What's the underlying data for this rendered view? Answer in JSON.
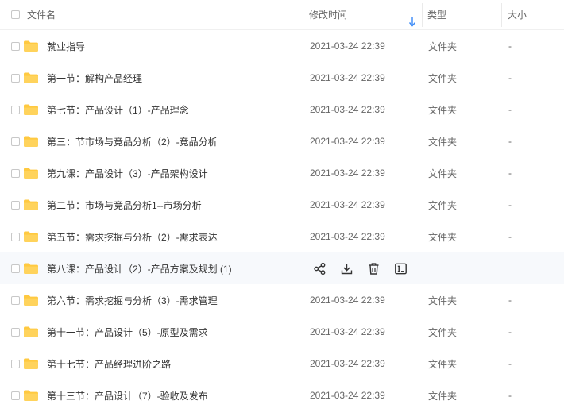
{
  "header": {
    "name": "文件名",
    "modified": "修改时间",
    "type": "类型",
    "size": "大小"
  },
  "colors": {
    "folder": "#FFC940",
    "sort_arrow": "#3889F7"
  },
  "hover_row_index": 7,
  "rows": [
    {
      "name": "就业指导",
      "time": "2021-03-24 22:39",
      "type": "文件夹",
      "size": "-"
    },
    {
      "name": "第一节：解构产品经理",
      "time": "2021-03-24 22:39",
      "type": "文件夹",
      "size": "-"
    },
    {
      "name": "第七节：产品设计（1）-产品理念",
      "time": "2021-03-24 22:39",
      "type": "文件夹",
      "size": "-"
    },
    {
      "name": "第三：节市场与竞品分析（2）-竞品分析",
      "time": "2021-03-24 22:39",
      "type": "文件夹",
      "size": "-"
    },
    {
      "name": "第九课：产品设计（3）-产品架构设计",
      "time": "2021-03-24 22:39",
      "type": "文件夹",
      "size": "-"
    },
    {
      "name": "第二节：市场与竞品分析1--市场分析",
      "time": "2021-03-24 22:39",
      "type": "文件夹",
      "size": "-"
    },
    {
      "name": "第五节：需求挖掘与分析（2）-需求表达",
      "time": "2021-03-24 22:39",
      "type": "文件夹",
      "size": "-"
    },
    {
      "name": "第八课：产品设计（2）-产品方案及规划 (1)",
      "time": "",
      "type": "",
      "size": ""
    },
    {
      "name": "第六节：需求挖掘与分析（3）-需求管理",
      "time": "2021-03-24 22:39",
      "type": "文件夹",
      "size": "-"
    },
    {
      "name": "第十一节：产品设计（5）-原型及需求",
      "time": "2021-03-24 22:39",
      "type": "文件夹",
      "size": "-"
    },
    {
      "name": "第十七节：产品经理进阶之路",
      "time": "2021-03-24 22:39",
      "type": "文件夹",
      "size": "-"
    },
    {
      "name": "第十三节：产品设计（7）-验收及发布",
      "time": "2021-03-24 22:39",
      "type": "文件夹",
      "size": "-"
    }
  ],
  "hover_actions": [
    "share-icon",
    "download-icon",
    "delete-icon",
    "rename-icon"
  ]
}
